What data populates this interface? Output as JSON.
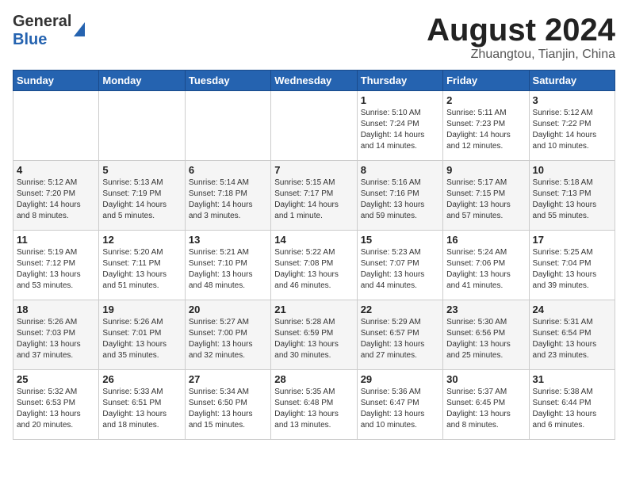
{
  "header": {
    "logo_general": "General",
    "logo_blue": "Blue",
    "title": "August 2024",
    "subtitle": "Zhuangtou, Tianjin, China"
  },
  "days_of_week": [
    "Sunday",
    "Monday",
    "Tuesday",
    "Wednesday",
    "Thursday",
    "Friday",
    "Saturday"
  ],
  "weeks": [
    [
      {
        "day": "",
        "info": ""
      },
      {
        "day": "",
        "info": ""
      },
      {
        "day": "",
        "info": ""
      },
      {
        "day": "",
        "info": ""
      },
      {
        "day": "1",
        "info": "Sunrise: 5:10 AM\nSunset: 7:24 PM\nDaylight: 14 hours\nand 14 minutes."
      },
      {
        "day": "2",
        "info": "Sunrise: 5:11 AM\nSunset: 7:23 PM\nDaylight: 14 hours\nand 12 minutes."
      },
      {
        "day": "3",
        "info": "Sunrise: 5:12 AM\nSunset: 7:22 PM\nDaylight: 14 hours\nand 10 minutes."
      }
    ],
    [
      {
        "day": "4",
        "info": "Sunrise: 5:12 AM\nSunset: 7:20 PM\nDaylight: 14 hours\nand 8 minutes."
      },
      {
        "day": "5",
        "info": "Sunrise: 5:13 AM\nSunset: 7:19 PM\nDaylight: 14 hours\nand 5 minutes."
      },
      {
        "day": "6",
        "info": "Sunrise: 5:14 AM\nSunset: 7:18 PM\nDaylight: 14 hours\nand 3 minutes."
      },
      {
        "day": "7",
        "info": "Sunrise: 5:15 AM\nSunset: 7:17 PM\nDaylight: 14 hours\nand 1 minute."
      },
      {
        "day": "8",
        "info": "Sunrise: 5:16 AM\nSunset: 7:16 PM\nDaylight: 13 hours\nand 59 minutes."
      },
      {
        "day": "9",
        "info": "Sunrise: 5:17 AM\nSunset: 7:15 PM\nDaylight: 13 hours\nand 57 minutes."
      },
      {
        "day": "10",
        "info": "Sunrise: 5:18 AM\nSunset: 7:13 PM\nDaylight: 13 hours\nand 55 minutes."
      }
    ],
    [
      {
        "day": "11",
        "info": "Sunrise: 5:19 AM\nSunset: 7:12 PM\nDaylight: 13 hours\nand 53 minutes."
      },
      {
        "day": "12",
        "info": "Sunrise: 5:20 AM\nSunset: 7:11 PM\nDaylight: 13 hours\nand 51 minutes."
      },
      {
        "day": "13",
        "info": "Sunrise: 5:21 AM\nSunset: 7:10 PM\nDaylight: 13 hours\nand 48 minutes."
      },
      {
        "day": "14",
        "info": "Sunrise: 5:22 AM\nSunset: 7:08 PM\nDaylight: 13 hours\nand 46 minutes."
      },
      {
        "day": "15",
        "info": "Sunrise: 5:23 AM\nSunset: 7:07 PM\nDaylight: 13 hours\nand 44 minutes."
      },
      {
        "day": "16",
        "info": "Sunrise: 5:24 AM\nSunset: 7:06 PM\nDaylight: 13 hours\nand 41 minutes."
      },
      {
        "day": "17",
        "info": "Sunrise: 5:25 AM\nSunset: 7:04 PM\nDaylight: 13 hours\nand 39 minutes."
      }
    ],
    [
      {
        "day": "18",
        "info": "Sunrise: 5:26 AM\nSunset: 7:03 PM\nDaylight: 13 hours\nand 37 minutes."
      },
      {
        "day": "19",
        "info": "Sunrise: 5:26 AM\nSunset: 7:01 PM\nDaylight: 13 hours\nand 35 minutes."
      },
      {
        "day": "20",
        "info": "Sunrise: 5:27 AM\nSunset: 7:00 PM\nDaylight: 13 hours\nand 32 minutes."
      },
      {
        "day": "21",
        "info": "Sunrise: 5:28 AM\nSunset: 6:59 PM\nDaylight: 13 hours\nand 30 minutes."
      },
      {
        "day": "22",
        "info": "Sunrise: 5:29 AM\nSunset: 6:57 PM\nDaylight: 13 hours\nand 27 minutes."
      },
      {
        "day": "23",
        "info": "Sunrise: 5:30 AM\nSunset: 6:56 PM\nDaylight: 13 hours\nand 25 minutes."
      },
      {
        "day": "24",
        "info": "Sunrise: 5:31 AM\nSunset: 6:54 PM\nDaylight: 13 hours\nand 23 minutes."
      }
    ],
    [
      {
        "day": "25",
        "info": "Sunrise: 5:32 AM\nSunset: 6:53 PM\nDaylight: 13 hours\nand 20 minutes."
      },
      {
        "day": "26",
        "info": "Sunrise: 5:33 AM\nSunset: 6:51 PM\nDaylight: 13 hours\nand 18 minutes."
      },
      {
        "day": "27",
        "info": "Sunrise: 5:34 AM\nSunset: 6:50 PM\nDaylight: 13 hours\nand 15 minutes."
      },
      {
        "day": "28",
        "info": "Sunrise: 5:35 AM\nSunset: 6:48 PM\nDaylight: 13 hours\nand 13 minutes."
      },
      {
        "day": "29",
        "info": "Sunrise: 5:36 AM\nSunset: 6:47 PM\nDaylight: 13 hours\nand 10 minutes."
      },
      {
        "day": "30",
        "info": "Sunrise: 5:37 AM\nSunset: 6:45 PM\nDaylight: 13 hours\nand 8 minutes."
      },
      {
        "day": "31",
        "info": "Sunrise: 5:38 AM\nSunset: 6:44 PM\nDaylight: 13 hours\nand 6 minutes."
      }
    ]
  ]
}
